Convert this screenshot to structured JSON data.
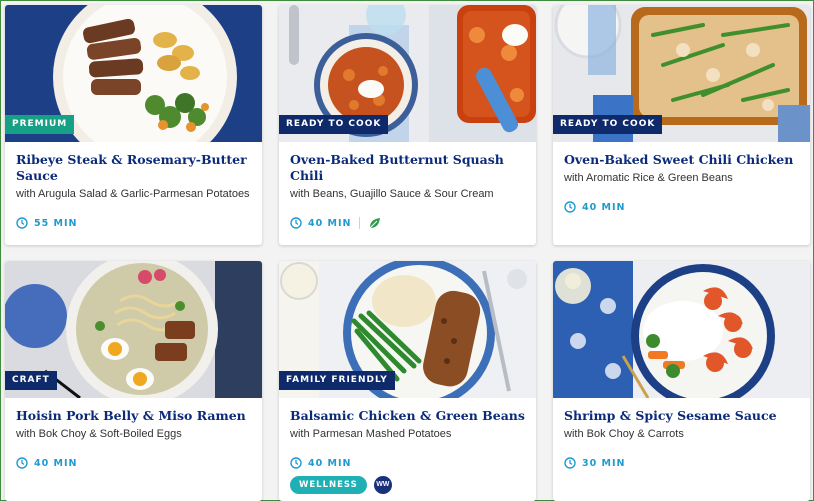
{
  "colors": {
    "title": "#0b2a7a",
    "time": "#1d9bd1",
    "tag_green": "#16a085",
    "tag_navy": "#0f2a6b",
    "wellness": "#1fb0b5"
  },
  "recipes": [
    {
      "tag": "PREMIUM",
      "title": "Ribeye Steak & Rosemary-Butter Sauce",
      "subtitle": "with Arugula Salad & Garlic-Parmesan Potatoes",
      "time": "55 MIN",
      "icons": [
        "clock-icon"
      ]
    },
    {
      "tag": "READY TO COOK",
      "title": "Oven-Baked Butternut Squash Chili",
      "subtitle": "with Beans, Guajillo Sauce & Sour Cream",
      "time": "40 MIN",
      "icons": [
        "clock-icon",
        "leaf-icon"
      ]
    },
    {
      "tag": "READY TO COOK",
      "title": "Oven-Baked Sweet Chili Chicken",
      "subtitle": "with Aromatic Rice & Green Beans",
      "time": "40 MIN",
      "icons": [
        "clock-icon"
      ]
    },
    {
      "tag": "CRAFT",
      "title": "Hoisin Pork Belly & Miso Ramen",
      "subtitle": "with Bok Choy & Soft-Boiled Eggs",
      "time": "40 MIN",
      "icons": [
        "clock-icon"
      ]
    },
    {
      "tag": "FAMILY FRIENDLY",
      "title": "Balsamic Chicken & Green Beans",
      "subtitle": "with Parmesan Mashed Potatoes",
      "time": "40 MIN",
      "icons": [
        "clock-icon"
      ],
      "badge": "WELLNESS",
      "badge2": "WW"
    },
    {
      "tag": "",
      "title": "Shrimp & Spicy Sesame Sauce",
      "subtitle": "with Bok Choy & Carrots",
      "time": "30 MIN",
      "icons": [
        "clock-icon"
      ]
    }
  ]
}
